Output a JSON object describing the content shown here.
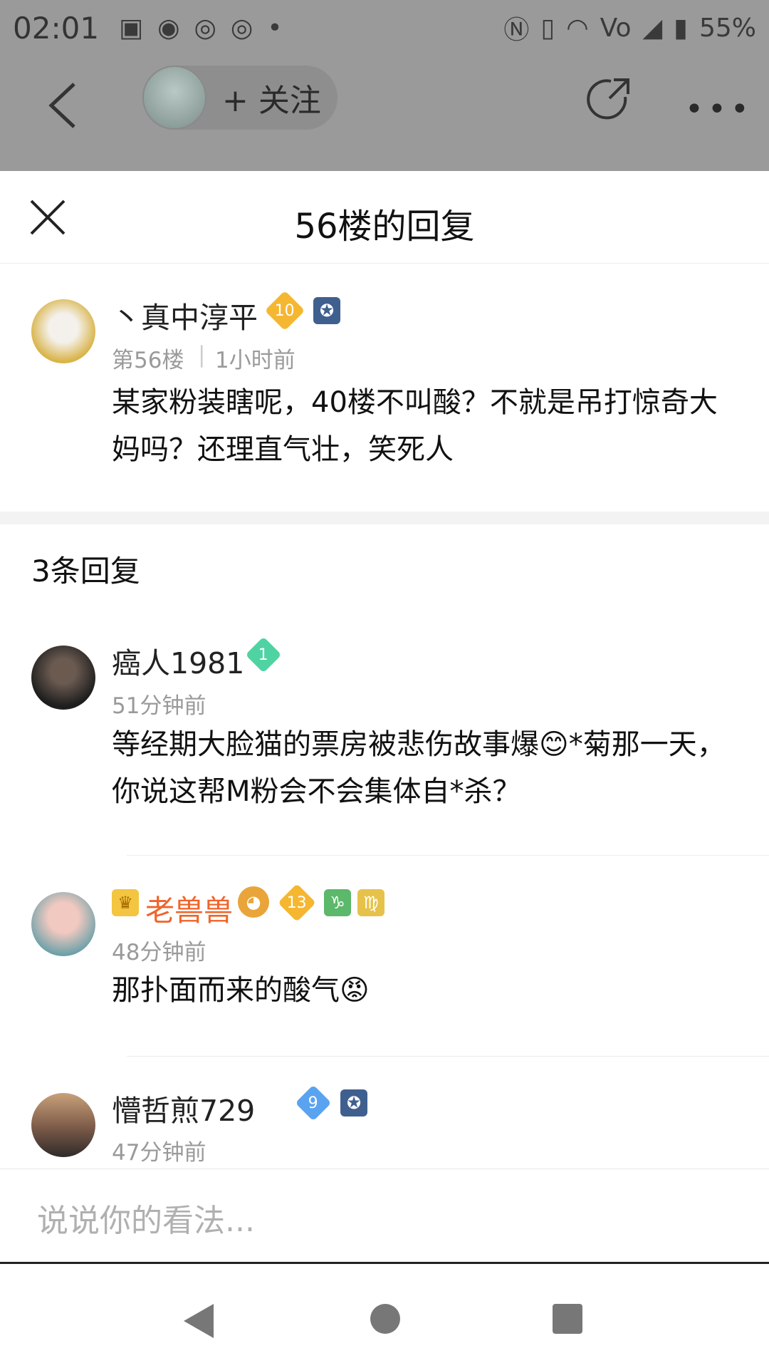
{
  "status_bar": {
    "time": "02:01",
    "battery": "55%"
  },
  "header": {
    "follow_label": "+ 关注"
  },
  "sheet": {
    "title": "56楼的回复"
  },
  "post": {
    "author": "丶真中淳平",
    "level": "10",
    "floor": "第56楼",
    "time": "1小时前",
    "text": "某家粉装瞎呢，40楼不叫酸？不就是吊打惊奇大妈吗？还理直气壮，笑死人"
  },
  "reply_count": "3条回复",
  "replies": [
    {
      "author": "癌人1981",
      "level": "1",
      "time": "51分钟前",
      "text": "等经期大脸猫的票房被悲伤故事爆😊*菊那一天，你说这帮M粉会不会集体自*杀？"
    },
    {
      "author": "老兽兽",
      "level": "13",
      "time": "48分钟前",
      "text": "那扑面而来的酸气😡"
    },
    {
      "author": "懵哲煎729",
      "level": "9",
      "time": "47分钟前"
    }
  ],
  "input": {
    "placeholder": "说说你的看法..."
  }
}
